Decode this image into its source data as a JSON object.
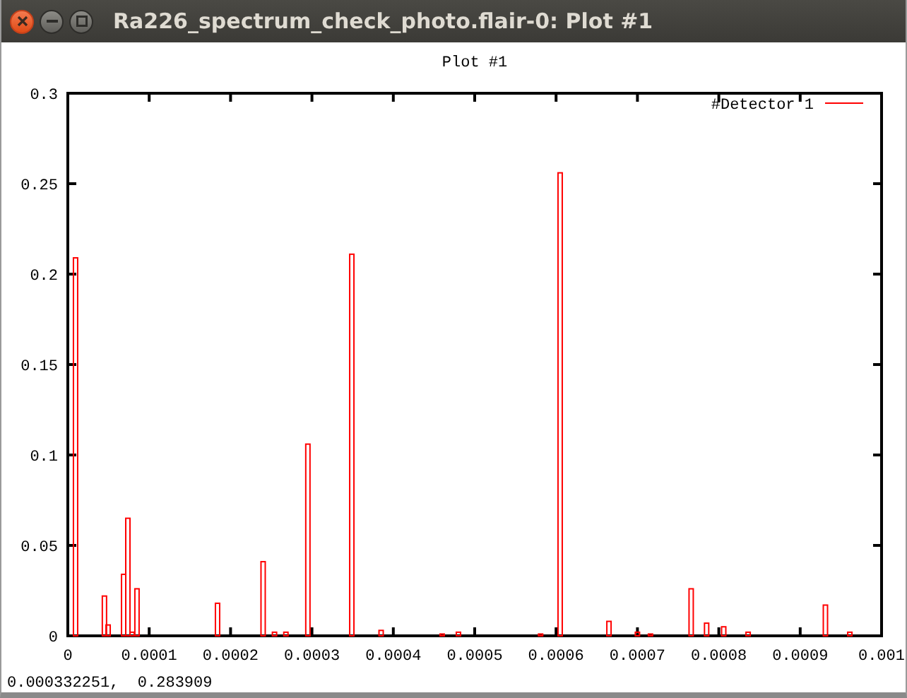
{
  "window": {
    "title": "Ra226_spectrum_check_photo.flair-0: Plot #1"
  },
  "plot": {
    "chart_data": {
      "type": "bar",
      "title": "Plot #1",
      "x": [
        9.5e-06,
        4.5e-05,
        4.95e-05,
        6.86e-05,
        7.38e-05,
        7.9e-05,
        8.5e-05,
        0.000184,
        0.00024,
        0.000254,
        0.000268,
        0.000295,
        0.000349,
        0.000385,
        0.00046,
        0.00048,
        0.000581,
        0.000605,
        0.000665,
        0.0007,
        0.000716,
        0.000766,
        0.000785,
        0.000806,
        0.000836,
        0.000931,
        0.000961
      ],
      "series": [
        {
          "name": "#Detector 1",
          "color": "#ff0000",
          "values": [
            0.209,
            0.022,
            0.006,
            0.034,
            0.065,
            0.002,
            0.026,
            0.018,
            0.041,
            0.002,
            0.002,
            0.106,
            0.211,
            0.003,
            0.001,
            0.002,
            0.001,
            0.256,
            0.008,
            0.002,
            0.001,
            0.026,
            0.007,
            0.005,
            0.002,
            0.017,
            0.002
          ]
        }
      ],
      "xlim": [
        0,
        0.001
      ],
      "ylim": [
        0,
        0.3
      ],
      "xticks": [
        0,
        0.0001,
        0.0002,
        0.0003,
        0.0004,
        0.0005,
        0.0006,
        0.0007,
        0.0008,
        0.0009,
        0.001
      ],
      "yticks": [
        0,
        0.05,
        0.1,
        0.15,
        0.2,
        0.25,
        0.3
      ]
    }
  },
  "status_bar": {
    "coordinates": "0.000332251,  0.283909"
  }
}
